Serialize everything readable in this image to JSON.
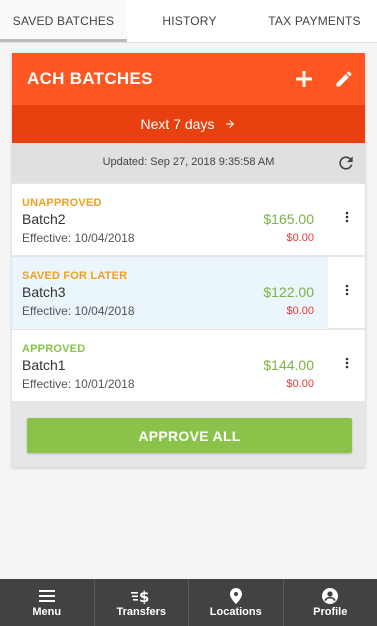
{
  "tabs": [
    {
      "label": "SAVED BATCHES",
      "active": true
    },
    {
      "label": "HISTORY",
      "active": false
    },
    {
      "label": "TAX PAYMENTS",
      "active": false
    }
  ],
  "header": {
    "title": "ACH BATCHES",
    "add_icon": "plus-icon",
    "edit_icon": "pencil-icon",
    "color": "#ff5722"
  },
  "range": {
    "label": "Next 7 days",
    "icon": "arrow-right-icon",
    "color": "#e8400f"
  },
  "updated": {
    "text": "Updated: Sep 27, 2018 9:35:58 AM",
    "icon": "refresh-icon"
  },
  "batches": [
    {
      "status": "UNAPPROVED",
      "status_color": "#f0a020",
      "name": "Batch2",
      "effective": "Effective: 10/04/2018",
      "amount": "$165.00",
      "sub_amount": "$0.00"
    },
    {
      "status": "SAVED FOR LATER",
      "status_color": "#f0a020",
      "name": "Batch3",
      "effective": "Effective: 10/04/2018",
      "amount": "$122.00",
      "sub_amount": "$0.00"
    },
    {
      "status": "APPROVED",
      "status_color": "#8bc34a",
      "name": "Batch1",
      "effective": "Effective: 10/01/2018",
      "amount": "$144.00",
      "sub_amount": "$0.00"
    }
  ],
  "amount_color": "#7cb342",
  "approve_button": {
    "label": "APPROVE ALL",
    "color": "#8bc34a"
  },
  "bottom_nav": [
    {
      "label": "Menu",
      "icon": "menu-icon"
    },
    {
      "label": "Transfers",
      "icon": "transfers-icon"
    },
    {
      "label": "Locations",
      "icon": "location-pin-icon"
    },
    {
      "label": "Profile",
      "icon": "profile-icon"
    }
  ]
}
